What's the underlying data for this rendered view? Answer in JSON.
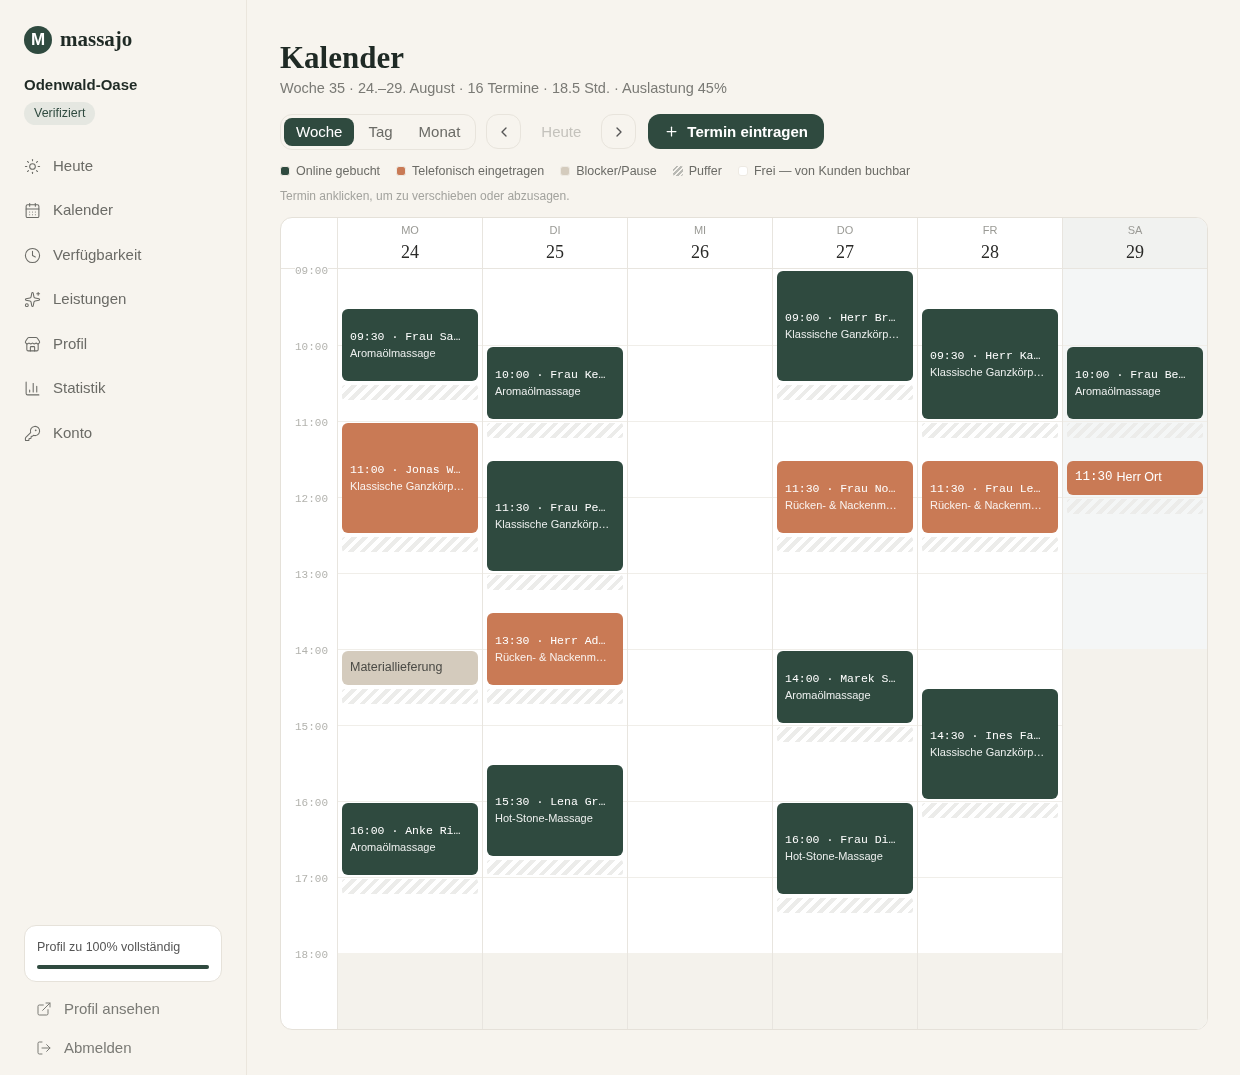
{
  "sidebar": {
    "logo": {
      "mark": "M",
      "name": "massajo"
    },
    "studio": "Odenwald-Oase",
    "badge": "Verifiziert",
    "nav": [
      {
        "label": "Heute"
      },
      {
        "label": "Kalender"
      },
      {
        "label": "Verfügbarkeit"
      },
      {
        "label": "Leistungen"
      },
      {
        "label": "Profil"
      },
      {
        "label": "Statistik"
      },
      {
        "label": "Konto"
      }
    ],
    "profile_progress": {
      "label": "Profil zu 100% vollständig",
      "level": 1
    },
    "links": [
      {
        "label": "Profil ansehen"
      },
      {
        "label": "Abmelden"
      }
    ]
  },
  "header": {
    "title": "Kalender",
    "subtitle": "Woche 35 · 24.–29. August · 16 Termine · 18.5 Std. · Auslastung 45%"
  },
  "toolbar": {
    "views": [
      {
        "label": "Woche",
        "selected": true
      },
      {
        "label": "Tag",
        "selected": false
      },
      {
        "label": "Monat",
        "selected": false
      }
    ],
    "today": {
      "label": "Heute",
      "disabled": true
    },
    "add_button": "Termin eintragen"
  },
  "legend": [
    {
      "kind": "dot",
      "label": "Online gebucht",
      "color": "#2f4a3f"
    },
    {
      "kind": "dot",
      "label": "Telefonisch eingetragen",
      "color": "#c97a55"
    },
    {
      "kind": "dot",
      "label": "Blocker/Pause",
      "color": "#d4cbbd"
    },
    {
      "kind": "hatch",
      "label": "Puffer"
    },
    {
      "kind": "dot",
      "label": "Frei — von Kunden buchbar",
      "color": "#ffffff"
    }
  ],
  "hint": "Termin anklicken, um zu verschieben oder abzusagen.",
  "calendar": {
    "hours": [
      "09:00",
      "10:00",
      "11:00",
      "12:00",
      "13:00",
      "14:00",
      "15:00",
      "16:00",
      "17:00",
      "18:00"
    ],
    "days": [
      {
        "weekday": "MO",
        "date": "24",
        "weekend": false,
        "quarter_slots": [
          {
            "kind": "free"
          },
          {
            "kind": "free"
          },
          {
            "kind": "online",
            "title": "09:30 · Frau Sa…",
            "service": "Aromaölmassage"
          },
          {
            "kind": "cont"
          },
          {
            "kind": "cont"
          },
          {
            "kind": "cont"
          },
          {
            "kind": "buffer"
          },
          {
            "kind": "free"
          },
          {
            "kind": "phone",
            "title": "11:00 · Jonas W…",
            "service": "Klassische Ganzkörp…"
          },
          {
            "kind": "cont"
          },
          {
            "kind": "cont"
          },
          {
            "kind": "cont"
          },
          {
            "kind": "cont"
          },
          {
            "kind": "cont"
          },
          {
            "kind": "buffer"
          },
          {
            "kind": "free"
          },
          {
            "kind": "free"
          },
          {
            "kind": "free"
          },
          {
            "kind": "free"
          },
          {
            "kind": "free"
          },
          {
            "kind": "blocker",
            "label": "Materiallieferung"
          },
          {
            "kind": "cont"
          },
          {
            "kind": "buffer"
          },
          {
            "kind": "free"
          },
          {
            "kind": "free"
          },
          {
            "kind": "free"
          },
          {
            "kind": "free"
          },
          {
            "kind": "free"
          },
          {
            "kind": "online",
            "title": "16:00 · Anke Ri…",
            "service": "Aromaölmassage"
          },
          {
            "kind": "cont"
          },
          {
            "kind": "cont"
          },
          {
            "kind": "cont"
          },
          {
            "kind": "buffer"
          },
          {
            "kind": "free"
          },
          {
            "kind": "free"
          },
          {
            "kind": "free"
          },
          {
            "kind": "closed"
          },
          {
            "kind": "cont"
          },
          {
            "kind": "cont"
          },
          {
            "kind": "cont"
          }
        ]
      },
      {
        "weekday": "DI",
        "date": "25",
        "weekend": false,
        "quarter_slots": [
          {
            "kind": "free"
          },
          {
            "kind": "free"
          },
          {
            "kind": "free"
          },
          {
            "kind": "free"
          },
          {
            "kind": "online",
            "title": "10:00 · Frau Ke…",
            "service": "Aromaölmassage"
          },
          {
            "kind": "cont"
          },
          {
            "kind": "cont"
          },
          {
            "kind": "cont"
          },
          {
            "kind": "buffer"
          },
          {
            "kind": "free"
          },
          {
            "kind": "online",
            "title": "11:30 · Frau Pe…",
            "service": "Klassische Ganzkörp…"
          },
          {
            "kind": "cont"
          },
          {
            "kind": "cont"
          },
          {
            "kind": "cont"
          },
          {
            "kind": "cont"
          },
          {
            "kind": "cont"
          },
          {
            "kind": "buffer"
          },
          {
            "kind": "free"
          },
          {
            "kind": "phone",
            "title": "13:30 · Herr Ad…",
            "service": "Rücken- & Nackenm…"
          },
          {
            "kind": "cont"
          },
          {
            "kind": "cont"
          },
          {
            "kind": "cont"
          },
          {
            "kind": "buffer"
          },
          {
            "kind": "free"
          },
          {
            "kind": "free"
          },
          {
            "kind": "free"
          },
          {
            "kind": "online",
            "title": "15:30 · Lena Gr…",
            "service": "Hot-Stone-Massage"
          },
          {
            "kind": "cont"
          },
          {
            "kind": "cont"
          },
          {
            "kind": "cont"
          },
          {
            "kind": "cont"
          },
          {
            "kind": "buffer"
          },
          {
            "kind": "free"
          },
          {
            "kind": "free"
          },
          {
            "kind": "free"
          },
          {
            "kind": "free"
          },
          {
            "kind": "closed"
          },
          {
            "kind": "cont"
          },
          {
            "kind": "cont"
          },
          {
            "kind": "cont"
          }
        ]
      },
      {
        "weekday": "MI",
        "date": "26",
        "weekend": false,
        "quarter_slots": [
          {
            "kind": "free"
          },
          {
            "kind": "free"
          },
          {
            "kind": "free"
          },
          {
            "kind": "free"
          },
          {
            "kind": "free"
          },
          {
            "kind": "free"
          },
          {
            "kind": "free"
          },
          {
            "kind": "free"
          },
          {
            "kind": "free"
          },
          {
            "kind": "free"
          },
          {
            "kind": "free"
          },
          {
            "kind": "free"
          },
          {
            "kind": "free"
          },
          {
            "kind": "free"
          },
          {
            "kind": "free"
          },
          {
            "kind": "free"
          },
          {
            "kind": "free"
          },
          {
            "kind": "free"
          },
          {
            "kind": "free"
          },
          {
            "kind": "free"
          },
          {
            "kind": "free"
          },
          {
            "kind": "free"
          },
          {
            "kind": "free"
          },
          {
            "kind": "free"
          },
          {
            "kind": "free"
          },
          {
            "kind": "free"
          },
          {
            "kind": "free"
          },
          {
            "kind": "free"
          },
          {
            "kind": "free"
          },
          {
            "kind": "free"
          },
          {
            "kind": "free"
          },
          {
            "kind": "free"
          },
          {
            "kind": "free"
          },
          {
            "kind": "free"
          },
          {
            "kind": "free"
          },
          {
            "kind": "free"
          },
          {
            "kind": "closed"
          },
          {
            "kind": "cont"
          },
          {
            "kind": "cont"
          },
          {
            "kind": "cont"
          }
        ]
      },
      {
        "weekday": "DO",
        "date": "27",
        "weekend": false,
        "quarter_slots": [
          {
            "kind": "online",
            "title": "09:00 · Herr Br…",
            "service": "Klassische Ganzkörp…"
          },
          {
            "kind": "cont"
          },
          {
            "kind": "cont"
          },
          {
            "kind": "cont"
          },
          {
            "kind": "cont"
          },
          {
            "kind": "cont"
          },
          {
            "kind": "buffer"
          },
          {
            "kind": "free"
          },
          {
            "kind": "free"
          },
          {
            "kind": "free"
          },
          {
            "kind": "phone",
            "title": "11:30 · Frau No…",
            "service": "Rücken- & Nackenm…"
          },
          {
            "kind": "cont"
          },
          {
            "kind": "cont"
          },
          {
            "kind": "cont"
          },
          {
            "kind": "buffer"
          },
          {
            "kind": "free"
          },
          {
            "kind": "free"
          },
          {
            "kind": "free"
          },
          {
            "kind": "free"
          },
          {
            "kind": "free"
          },
          {
            "kind": "online",
            "title": "14:00 · Marek S…",
            "service": "Aromaölmassage"
          },
          {
            "kind": "cont"
          },
          {
            "kind": "cont"
          },
          {
            "kind": "cont"
          },
          {
            "kind": "buffer"
          },
          {
            "kind": "free"
          },
          {
            "kind": "free"
          },
          {
            "kind": "free"
          },
          {
            "kind": "online",
            "title": "16:00 · Frau Di…",
            "service": "Hot-Stone-Massage"
          },
          {
            "kind": "cont"
          },
          {
            "kind": "cont"
          },
          {
            "kind": "cont"
          },
          {
            "kind": "cont"
          },
          {
            "kind": "buffer"
          },
          {
            "kind": "free"
          },
          {
            "kind": "free"
          },
          {
            "kind": "closed"
          },
          {
            "kind": "cont"
          },
          {
            "kind": "cont"
          },
          {
            "kind": "cont"
          }
        ]
      },
      {
        "weekday": "FR",
        "date": "28",
        "weekend": false,
        "quarter_slots": [
          {
            "kind": "free"
          },
          {
            "kind": "free"
          },
          {
            "kind": "online",
            "title": "09:30 · Herr Ka…",
            "service": "Klassische Ganzkörp…"
          },
          {
            "kind": "cont"
          },
          {
            "kind": "cont"
          },
          {
            "kind": "cont"
          },
          {
            "kind": "cont"
          },
          {
            "kind": "cont"
          },
          {
            "kind": "buffer"
          },
          {
            "kind": "free"
          },
          {
            "kind": "phone",
            "title": "11:30 · Frau Le…",
            "service": "Rücken- & Nackenm…"
          },
          {
            "kind": "cont"
          },
          {
            "kind": "cont"
          },
          {
            "kind": "cont"
          },
          {
            "kind": "buffer"
          },
          {
            "kind": "free"
          },
          {
            "kind": "free"
          },
          {
            "kind": "free"
          },
          {
            "kind": "free"
          },
          {
            "kind": "free"
          },
          {
            "kind": "free"
          },
          {
            "kind": "free"
          },
          {
            "kind": "online",
            "title": "14:30 · Ines Fa…",
            "service": "Klassische Ganzkörp…"
          },
          {
            "kind": "cont"
          },
          {
            "kind": "cont"
          },
          {
            "kind": "cont"
          },
          {
            "kind": "cont"
          },
          {
            "kind": "cont"
          },
          {
            "kind": "buffer"
          },
          {
            "kind": "free"
          },
          {
            "kind": "free"
          },
          {
            "kind": "free"
          },
          {
            "kind": "free"
          },
          {
            "kind": "free"
          },
          {
            "kind": "free"
          },
          {
            "kind": "free"
          },
          {
            "kind": "closed"
          },
          {
            "kind": "cont"
          },
          {
            "kind": "cont"
          },
          {
            "kind": "cont"
          }
        ]
      },
      {
        "weekday": "SA",
        "date": "29",
        "weekend": true,
        "quarter_slots": [
          {
            "kind": "free"
          },
          {
            "kind": "free"
          },
          {
            "kind": "free"
          },
          {
            "kind": "free"
          },
          {
            "kind": "online",
            "title": "10:00 · Frau Be…",
            "service": "Aromaölmassage"
          },
          {
            "kind": "cont"
          },
          {
            "kind": "cont"
          },
          {
            "kind": "cont"
          },
          {
            "kind": "buffer"
          },
          {
            "kind": "free"
          },
          {
            "kind": "phone_short",
            "time": "11:30",
            "client": "Herr Ort"
          },
          {
            "kind": "cont"
          },
          {
            "kind": "buffer"
          },
          {
            "kind": "free"
          },
          {
            "kind": "free"
          },
          {
            "kind": "free"
          },
          {
            "kind": "free"
          },
          {
            "kind": "free"
          },
          {
            "kind": "free"
          },
          {
            "kind": "free"
          },
          {
            "kind": "closed"
          },
          {
            "kind": "cont"
          },
          {
            "kind": "cont"
          },
          {
            "kind": "cont"
          },
          {
            "kind": "cont"
          },
          {
            "kind": "cont"
          },
          {
            "kind": "cont"
          },
          {
            "kind": "cont"
          },
          {
            "kind": "cont"
          },
          {
            "kind": "cont"
          },
          {
            "kind": "cont"
          },
          {
            "kind": "cont"
          },
          {
            "kind": "cont"
          },
          {
            "kind": "cont"
          },
          {
            "kind": "cont"
          },
          {
            "kind": "cont"
          },
          {
            "kind": "cont"
          },
          {
            "kind": "cont"
          },
          {
            "kind": "cont"
          },
          {
            "kind": "cont"
          }
        ]
      }
    ]
  }
}
